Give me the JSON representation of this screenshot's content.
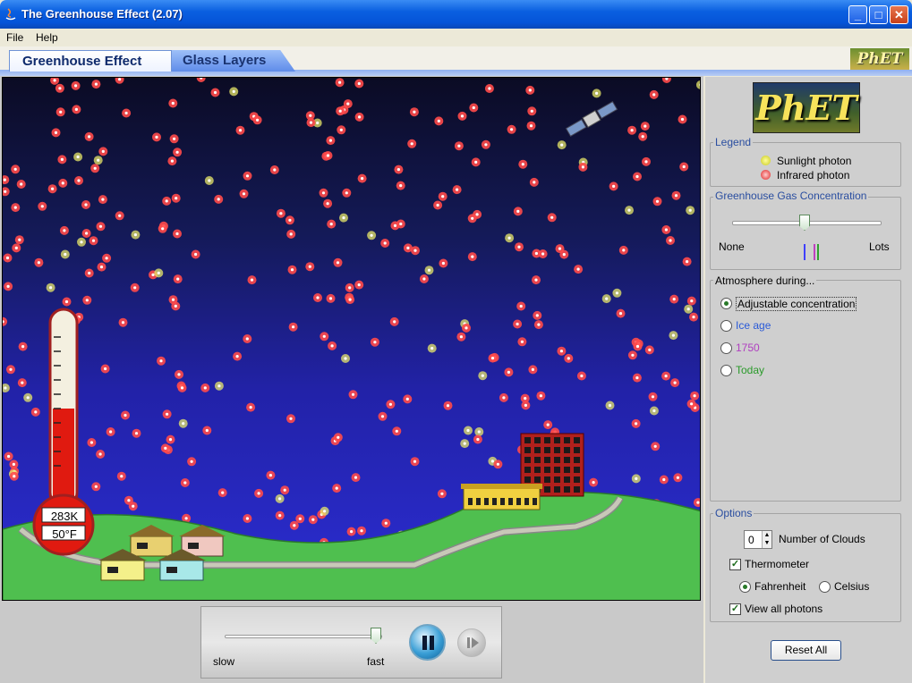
{
  "window": {
    "title": "The Greenhouse Effect (2.07)"
  },
  "menu": {
    "items": [
      "File",
      "Help"
    ]
  },
  "tabs": [
    {
      "label": "Greenhouse Effect",
      "active": true
    },
    {
      "label": "Glass Layers",
      "active": false
    }
  ],
  "logo": {
    "small": "PhET",
    "large": "PhET"
  },
  "thermometer": {
    "kelvin": "283K",
    "fahrenheit": "50°F",
    "level_fraction": 0.5
  },
  "legend": {
    "title": "Legend",
    "sunlight": "Sunlight photon",
    "infrared": "Infrared photon",
    "sunlight_color": "#e8e86a",
    "infrared_color": "#ff4a4a"
  },
  "gas": {
    "title": "Greenhouse Gas Concentration",
    "min_label": "None",
    "max_label": "Lots",
    "level_fraction": 0.47,
    "marker_colors": [
      "#4040ff",
      "#c040c0",
      "#30a030"
    ]
  },
  "atmosphere": {
    "title": "Atmosphere during...",
    "options": [
      {
        "label": "Adjustable concentration",
        "color": "#000000",
        "selected": true
      },
      {
        "label": "Ice age",
        "color": "#2a5ad8",
        "selected": false
      },
      {
        "label": "1750",
        "color": "#b040c0",
        "selected": false
      },
      {
        "label": "Today",
        "color": "#2a9a2a",
        "selected": false
      }
    ]
  },
  "options": {
    "title": "Options",
    "clouds_value": "0",
    "clouds_label": "Number of Clouds",
    "thermometer_label": "Thermometer",
    "thermometer_checked": true,
    "fahrenheit_label": "Fahrenheit",
    "celsius_label": "Celsius",
    "fahrenheit_selected": true,
    "view_photons_label": "View all photons",
    "view_photons_checked": true
  },
  "reset_label": "Reset All",
  "clock": {
    "slow_label": "slow",
    "fast_label": "fast",
    "speed_fraction": 0.95
  },
  "colors": {
    "ground": "#4fbf4f",
    "sky_top": "#0b0b24",
    "sky_bottom": "#2b2dd2",
    "building": "#b0201c"
  }
}
